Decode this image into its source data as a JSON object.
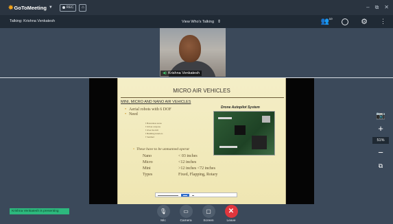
{
  "app": {
    "brand": "GoToMeeting",
    "rec_label": "REC"
  },
  "toolbar": {
    "talking": "Talking: Krishna Venkatesh",
    "view_mode": "View Who's Talking",
    "attendee_count": "10"
  },
  "webcam": {
    "name": "Krishna Venkatesh"
  },
  "slide": {
    "title": "MICRO AIR VEHICLES",
    "subtitle": "MINI, MICRO AND NANO AIR VEHICLES",
    "bullets": [
      "Aerial robots with 6 DOF",
      "Need"
    ],
    "sub_bullets": [
      "Hazardous areas",
      "Urban canyons",
      "Over the hill",
      "Building interiors",
      "Sentinel"
    ],
    "image_label": "Drone Autopilot System",
    "tail_note": "These have to be unmanned operat",
    "specs": [
      {
        "k": "Nano",
        "v": "< 03 inches"
      },
      {
        "k": "Micro",
        "v": "<12 inches"
      },
      {
        "k": "Mini",
        "v": ">12 inches <72 inches"
      },
      {
        "k": "Types",
        "v": "Fixed, Flapping, Rotary"
      }
    ]
  },
  "zoom": {
    "level": "51%"
  },
  "status": {
    "presenting": "Krishna Venkatesh is presenting"
  },
  "controls": {
    "mic": "Mic",
    "camera": "Camera",
    "screen": "Screen",
    "leave": "Leave"
  },
  "colors": {
    "stage": "#3b495a",
    "toolbar": "#202a35",
    "status_green": "#2db87d",
    "leave_red": "#e0363d",
    "slide_bg": "#f4eec7"
  }
}
